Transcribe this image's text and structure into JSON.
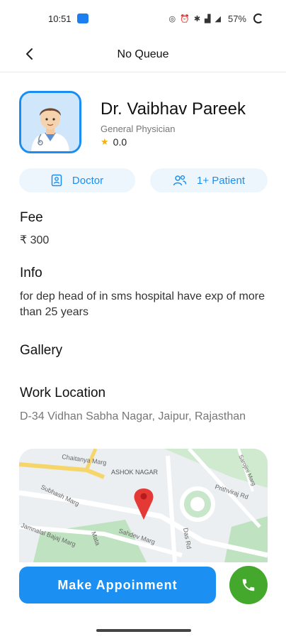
{
  "status_bar": {
    "time": "10:51",
    "battery": "57%"
  },
  "header": {
    "title": "No Queue",
    "back_icon": "chevron-left-icon"
  },
  "doctor": {
    "name": "Dr. Vaibhav Pareek",
    "specialty": "General Physician",
    "rating": "0.0"
  },
  "tags": {
    "doctor_label": "Doctor",
    "patient_label": "1+ Patient"
  },
  "fee": {
    "title": "Fee",
    "value": "₹ 300"
  },
  "info": {
    "title": "Info",
    "text": "for dep head of in sms hospital have exp of more than 25 years"
  },
  "gallery": {
    "title": "Gallery"
  },
  "work_location": {
    "title": "Work Location",
    "address": "D-34 Vidhan Sabha Nagar, Jaipur, Rajasthan"
  },
  "map_labels": {
    "chaitanya": "Chaitanya Marg",
    "ashok_nagar": "ASHOK NAGAR",
    "sarojini": "Sarojini Marg",
    "subhash": "Subhash Marg",
    "prithviraj": "Prithviraj Rd",
    "jamnalal": "Jamnalal Bajaj Marg",
    "sahdev": "Sahdev Marg",
    "das_rd": "Das Rd",
    "mata": "Mata"
  },
  "actions": {
    "book_label": "Make Appoinment",
    "call_icon": "phone-icon"
  },
  "colors": {
    "accent": "#1b8ff2",
    "call_green": "#43a82c",
    "pill_bg": "#eef6fd",
    "star": "#f5b301",
    "map_pin": "#e53935"
  }
}
